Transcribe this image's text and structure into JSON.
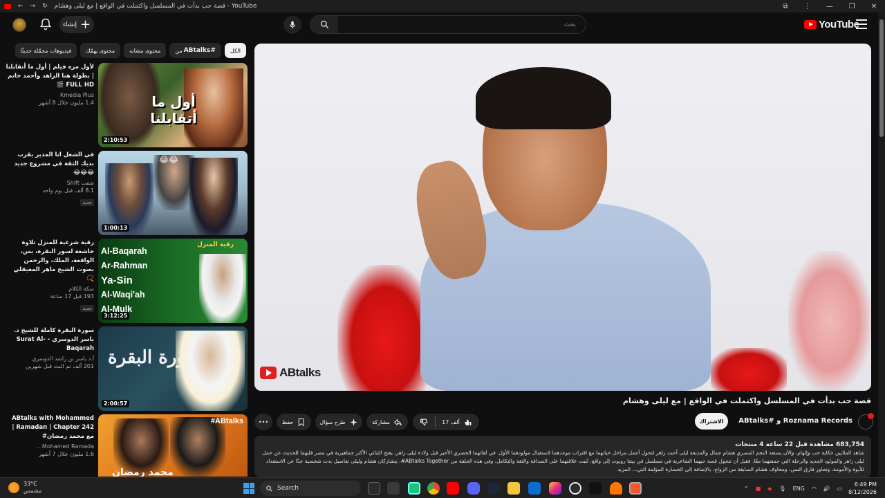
{
  "browser": {
    "tab_title": "قصة حب بدأت في المسلسل واكتملت في الواقع | مع ليلى وهشام - YouTube",
    "window_controls": [
      "—",
      "❐",
      "✕"
    ]
  },
  "masthead": {
    "create_label": "إنشاء",
    "search_placeholder": "بحث",
    "logo_text": "YouTube"
  },
  "chips": [
    {
      "label": "الكل",
      "active": true
    },
    {
      "label": "من ",
      "bold": "ABtalks#",
      "active": false
    },
    {
      "label": "محتوى مشابه",
      "active": false
    },
    {
      "label": "محتوى يهمّك",
      "active": false
    },
    {
      "label": "فيديوهات محمّلة حديثًا",
      "active": false
    }
  ],
  "recommendations": [
    {
      "title": "لأول مره فيلم | أول ما أتقابلنا | بطولة هنا الزاهد وأحمد حاتم FULL HD 🎬",
      "channel": "Kmedia Plus",
      "stats": "1.4 مليون  خلال 8 أشهر",
      "badge": "",
      "duration": "2:10:53",
      "thumb_text": "أول ما أتقابلنا"
    },
    {
      "title": "في الشغل انا المدير بقرب بديك الثقة في مشروع جديد 😂😂😂",
      "channel": "شفت Shift",
      "stats": "8.1 ألف  قبل يوم واحد",
      "badge": "جديد",
      "duration": "1:00:13",
      "thumb_text": ""
    },
    {
      "title": "رقية شرعية للمنزل  تلاوة خاشعة لسور البقرة، يس، الواقعة، الملك، والرحمن بصوت الشيخ ماهر المعيقلي 📿",
      "channel": "سكة الكلام",
      "stats": "193  قبل 17 ساعة",
      "badge": "جديد",
      "duration": "3:12:25",
      "thumb_text": "رقية المنزل",
      "thumb_lines": [
        "Al-Baqarah",
        "Ar-Rahman",
        "Ya-Sin",
        "Al-Waqi'ah",
        "Al-Mulk"
      ]
    },
    {
      "title": "سورة البقرة كاملة للشيخ د. ياسر الدوسري - Surat Al-Baqarah",
      "channel": "أ.د ياسر بن راشد الدوسري",
      "stats": "201 ألف  تم البث قبل شهرين",
      "badge": "",
      "duration": "2:00:57",
      "thumb_text": "سُورة البقرة"
    },
    {
      "title": "ABtalks with Mohammed Ramadan | Chapter 242 | مع محمد رمضان#",
      "channel": "Mohamed Ramada...",
      "stats": "1.6 مليون  خلال 7 أشهر",
      "badge": "",
      "duration": "",
      "thumb_text": "#ABtalks",
      "thumb_sub": "محمد رمضان"
    }
  ],
  "player": {
    "watermark": "ABtalks"
  },
  "video": {
    "title": "قصة حب بدأت في المسلسل واكتملت في الواقع | مع ليلى وهشام",
    "channel": "ABtalks# و Roznama Records",
    "subscribe_label": "الاشتراك",
    "likes": "17 ألف",
    "share_label": "مشاركة",
    "ask_label": "طرح سؤال",
    "save_label": "حفظ",
    "more_label": "•••"
  },
  "description": {
    "stats": "683,754 مشاهدة  قبل 22 ساعة  4 منتجات",
    "text": "شاهد الملايين حكاية حب وإلهام، والآن يستعد النجم المصري هشام جمال والمذيعة ليلى أحمد زاهر لتحول أجمل مراحل حياتهما مع اقتراب موعدهما لاستقبال مولودهما الأول. في لقائهما الحصري الأخير قبل ولادة ليلى زاهر، يفتح الثنائي الأكثر جماهيرية في مصر قلبهما للحديث عن حمل ليلى زاهر والمولود الجديد والرحلة التي جمعتهما معًا. فقبل أن تتحول قصة حبهما الشاعرية في مسلسل في بيتنا روبوت إلى واقع، تُثبت علاقتهما على الصداقة والثقة والتكامل، وفي هذه الحلقة من ABtalks Together#، يتشاركان هشام وليلى تفاصيل بدت شخصية جدًا عن الاستعداد للأبوة والأمومة، وتجاوز فارق السن، ومخاوف هشام السابقة من الزواج، بالإضافة إلى الخسارة المؤلمة التي... المزيد"
  },
  "taskbar": {
    "temperature": "33°C",
    "condition": "مشمس",
    "search_label": "Search",
    "language": "ENG",
    "time": "6:49 PM",
    "date": "8/12/2026"
  },
  "colors": {
    "brand_red": "#ff0000",
    "bg": "#0f0f0f",
    "surface": "#272727",
    "text": "#f1f1f1",
    "muted": "#aaaaaa"
  }
}
